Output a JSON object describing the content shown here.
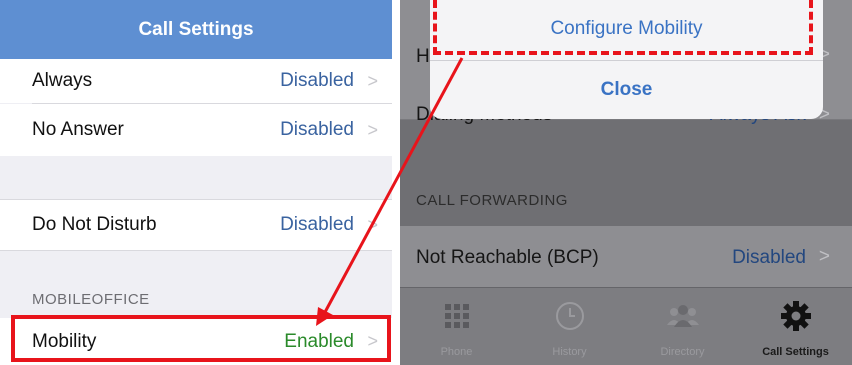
{
  "left": {
    "title": "Call Settings",
    "rows": [
      {
        "label": "Always",
        "value": "Disabled"
      },
      {
        "label": "No Answer",
        "value": "Disabled"
      },
      {
        "label": "Do Not Disturb",
        "value": "Disabled"
      },
      {
        "label": "Mobility",
        "value": "Enabled"
      }
    ],
    "section_mobileoffice": "MOBILEOFFICE",
    "chevron": ">"
  },
  "right": {
    "sheet": {
      "configure_label": "Configure Mobility",
      "close_label": "Close"
    },
    "partial_row_1_label": "H",
    "partial_row_2_label": "Dialing Methods",
    "partial_row_2_value": "Always Ask",
    "section_call_forwarding": "CALL FORWARDING",
    "not_reachable_label": "Not Reachable (BCP)",
    "not_reachable_value": "Disabled",
    "chevron": ">",
    "tabs": [
      {
        "label": "Phone",
        "icon": "keypad-icon"
      },
      {
        "label": "History",
        "icon": "clock-icon"
      },
      {
        "label": "Directory",
        "icon": "contacts-icon"
      },
      {
        "label": "Call Settings",
        "icon": "gear-icon"
      }
    ]
  },
  "colors": {
    "nav_blue": "#5e8fd2",
    "value_blue": "#3a63a0",
    "enabled_green": "#2a8a2a",
    "highlight_red": "#e8141b"
  }
}
